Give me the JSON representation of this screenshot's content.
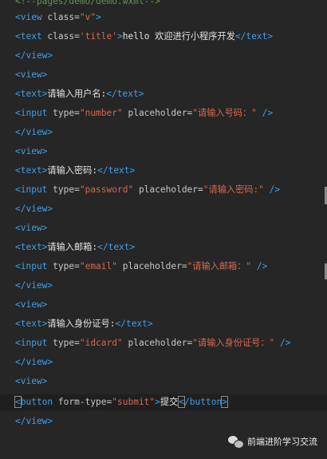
{
  "code": {
    "l00": "<!--pages/demo/demo.wxml-->",
    "l01_open": "<view",
    "l01_attr": " class=",
    "l01_val": "\"v\"",
    "l01_close": ">",
    "l02_open": "<text",
    "l02_attr": " class=",
    "l02_val": "'title'",
    "l02_gt": ">",
    "l02_text": "hello 欢迎进行小程序开发",
    "l02_close": "</text>",
    "l03": "</view>",
    "l04": "<view>",
    "l05_open": "<text>",
    "l05_text": "请输入用户名:",
    "l05_close": "</text>",
    "l06_open": "<input",
    "l06_attr1": " type=",
    "l06_val1": "\"number\"",
    "l06_attr2": " placeholder=",
    "l06_val2": "\"请输入号码：\"",
    "l06_close": " />",
    "l07": "</view>",
    "l08": "<view>",
    "l09_open": "<text>",
    "l09_text": "请输入密码:",
    "l09_close": "</text>",
    "l10_open": "<input",
    "l10_attr1": " type=",
    "l10_val1": "\"password\"",
    "l10_attr2": " placeholder=",
    "l10_val2": "\"请输入密码:\"",
    "l10_close": " />",
    "l11": "</view>",
    "l12": "<view>",
    "l13_open": "<text>",
    "l13_text": "请输入邮箱:",
    "l13_close": "</text>",
    "l14_open": "<input",
    "l14_attr1": " type=",
    "l14_val1": "\"email\"",
    "l14_attr2": " placeholder=",
    "l14_val2": "\"请输入邮箱：\"",
    "l14_close": " />",
    "l15": "</view>",
    "l16": "<view>",
    "l17_open": "<text>",
    "l17_text": "请输入身份证号:",
    "l17_close": "</text>",
    "l18_open": "<input",
    "l18_attr1": " type=",
    "l18_val1": "\"idcard\"",
    "l18_attr2": " placeholder=",
    "l18_val2": "\"请输入身份证号：\"",
    "l18_close": " />",
    "l19": "</view>",
    "l20": "<view>",
    "l21_lt": "<",
    "l21_tag": "button",
    "l21_attr": " form-type=",
    "l21_val": "\"submit\"",
    "l21_gt": ">",
    "l21_text": "提交",
    "l21_close_lt": "<",
    "l21_close_tag": "/button",
    "l21_close_gt": ">",
    "l22": "</view>"
  },
  "watermark": {
    "label": "前端进阶学习交流",
    "icon": "wechat-icon"
  }
}
